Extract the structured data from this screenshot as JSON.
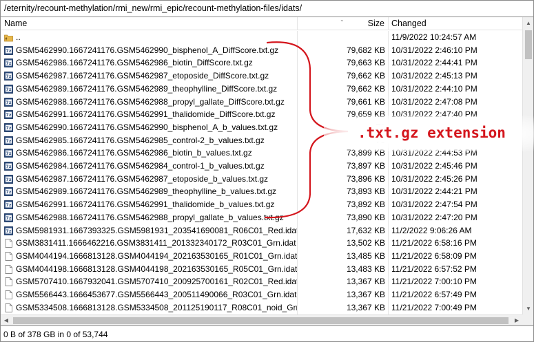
{
  "path": "/eternity/recount-methylation/rmi_new/rmi_epic/recount-methylation-files/idats/",
  "columns": {
    "name": "Name",
    "size": "Size",
    "changed": "Changed"
  },
  "files": [
    {
      "name": "..",
      "size": "",
      "changed": "11/9/2022 10:24:57 AM",
      "icon": "parent-folder-icon"
    },
    {
      "name": "GSM5462990.1667241176.GSM5462990_bisphenol_A_DiffScore.txt.gz",
      "size": "79,682 KB",
      "changed": "10/31/2022 2:46:10 PM",
      "icon": "gz-archive-icon"
    },
    {
      "name": "GSM5462986.1667241176.GSM5462986_biotin_DiffScore.txt.gz",
      "size": "79,663 KB",
      "changed": "10/31/2022 2:44:41 PM",
      "icon": "gz-archive-icon"
    },
    {
      "name": "GSM5462987.1667241176.GSM5462987_etoposide_DiffScore.txt.gz",
      "size": "79,662 KB",
      "changed": "10/31/2022 2:45:13 PM",
      "icon": "gz-archive-icon"
    },
    {
      "name": "GSM5462989.1667241176.GSM5462989_theophylline_DiffScore.txt.gz",
      "size": "79,662 KB",
      "changed": "10/31/2022 2:44:10 PM",
      "icon": "gz-archive-icon"
    },
    {
      "name": "GSM5462988.1667241176.GSM5462988_propyl_gallate_DiffScore.txt.gz",
      "size": "79,661 KB",
      "changed": "10/31/2022 2:47:08 PM",
      "icon": "gz-archive-icon"
    },
    {
      "name": "GSM5462991.1667241176.GSM5462991_thalidomide_DiffScore.txt.gz",
      "size": "79,659 KB",
      "changed": "10/31/2022 2:47:40 PM",
      "icon": "gz-archive-icon"
    },
    {
      "name": "GSM5462990.1667241176.GSM5462990_bisphenol_A_b_values.txt.gz",
      "size": "73",
      "changed": "",
      "icon": "gz-archive-icon"
    },
    {
      "name": "GSM5462985.1667241176.GSM5462985_control-2_b_values.txt.gz",
      "size": "73",
      "changed": "",
      "icon": "gz-archive-icon"
    },
    {
      "name": "GSM5462986.1667241176.GSM5462986_biotin_b_values.txt.gz",
      "size": "73,899 KB",
      "changed": "10/31/2022 2:44:53 PM",
      "icon": "gz-archive-icon"
    },
    {
      "name": "GSM5462984.1667241176.GSM5462984_control-1_b_values.txt.gz",
      "size": "73,897 KB",
      "changed": "10/31/2022 2:45:46 PM",
      "icon": "gz-archive-icon"
    },
    {
      "name": "GSM5462987.1667241176.GSM5462987_etoposide_b_values.txt.gz",
      "size": "73,896 KB",
      "changed": "10/31/2022 2:45:26 PM",
      "icon": "gz-archive-icon"
    },
    {
      "name": "GSM5462989.1667241176.GSM5462989_theophylline_b_values.txt.gz",
      "size": "73,893 KB",
      "changed": "10/31/2022 2:44:21 PM",
      "icon": "gz-archive-icon"
    },
    {
      "name": "GSM5462991.1667241176.GSM5462991_thalidomide_b_values.txt.gz",
      "size": "73,892 KB",
      "changed": "10/31/2022 2:47:54 PM",
      "icon": "gz-archive-icon"
    },
    {
      "name": "GSM5462988.1667241176.GSM5462988_propyl_gallate_b_values.txt.gz",
      "size": "73,890 KB",
      "changed": "10/31/2022 2:47:20 PM",
      "icon": "gz-archive-icon"
    },
    {
      "name": "GSM5981931.1667393325.GSM5981931_203541690081_R06C01_Red.idat.gz",
      "size": "17,632 KB",
      "changed": "11/2/2022 9:06:26 AM",
      "icon": "gz-archive-icon"
    },
    {
      "name": "GSM3831411.1666462216.GSM3831411_201332340172_R03C01_Grn.idat",
      "size": "13,502 KB",
      "changed": "11/21/2022 6:58:16 PM",
      "icon": "file-icon"
    },
    {
      "name": "GSM4044194.1666813128.GSM4044194_202163530165_R01C01_Grn.idat",
      "size": "13,485 KB",
      "changed": "11/21/2022 6:58:09 PM",
      "icon": "file-icon"
    },
    {
      "name": "GSM4044198.1666813128.GSM4044198_202163530165_R05C01_Grn.idat",
      "size": "13,483 KB",
      "changed": "11/21/2022 6:57:52 PM",
      "icon": "file-icon"
    },
    {
      "name": "GSM5707410.1667932041.GSM5707410_200925700161_R02C01_Red.idat",
      "size": "13,367 KB",
      "changed": "11/21/2022 7:00:10 PM",
      "icon": "file-icon"
    },
    {
      "name": "GSM5566443.1666453677.GSM5566443_200511490066_R03C01_Grn.idat",
      "size": "13,367 KB",
      "changed": "11/21/2022 6:57:49 PM",
      "icon": "file-icon"
    },
    {
      "name": "GSM5334508.1666813128.GSM5334508_201125190117_R08C01_noid_Grn.idat",
      "size": "13,367 KB",
      "changed": "11/21/2022 7:00:49 PM",
      "icon": "file-icon"
    }
  ],
  "callout": {
    "text": ".txt.gz extension"
  },
  "status": "0 B of 378 GB in 0 of 53,744",
  "colors": {
    "annotation": "#d4161d"
  }
}
